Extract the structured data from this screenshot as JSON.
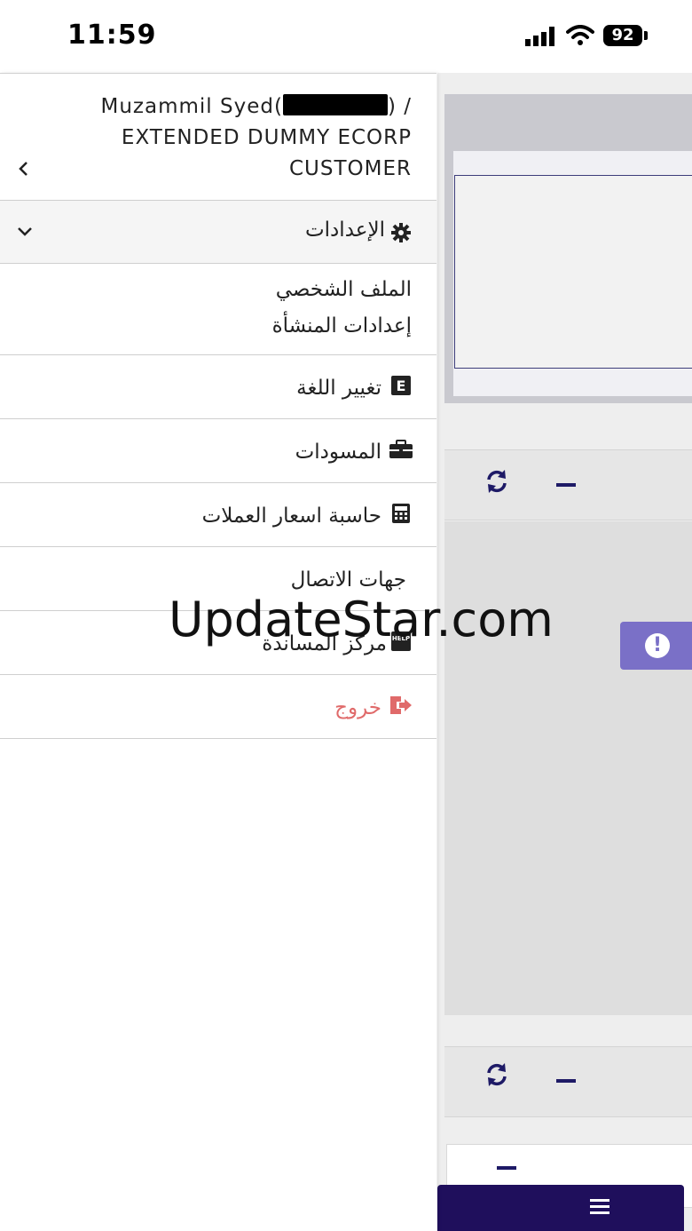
{
  "status_bar": {
    "time": "11:59",
    "battery": "92"
  },
  "drawer": {
    "user_line1": "Muzammil Syed(",
    "user_line1_end": ") /",
    "user_line2": "EXTENDED DUMMY ECORP",
    "user_line3": "CUSTOMER",
    "settings_label": "الإعدادات",
    "sub_items": [
      "الملف الشخصي",
      "إعدادات المنشأة"
    ],
    "items": [
      {
        "label": "تغيير اللغة",
        "icon": "language-icon"
      },
      {
        "label": "المسودات",
        "icon": "briefcase-icon"
      },
      {
        "label": "حاسبة اسعار العملات",
        "icon": "calculator-icon"
      },
      {
        "label": "جهات الاتصال",
        "icon": ""
      },
      {
        "label": "مركز المساندة",
        "icon": "help-icon"
      },
      {
        "label": "خروج",
        "icon": "logout-icon"
      }
    ]
  },
  "watermark": "UpdateStar.com",
  "colors": {
    "accent": "#1f0f5c",
    "alert": "#7a70c7",
    "logout": "#e06a6a"
  }
}
